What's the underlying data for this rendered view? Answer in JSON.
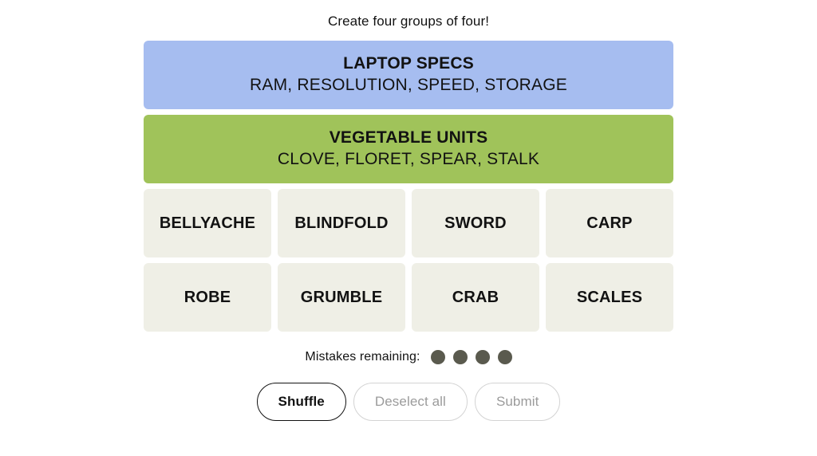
{
  "game": {
    "tagline": "Create four groups of four!",
    "palette": {
      "page_background": "#ffffff",
      "tile_background": "#efefe6",
      "tile_text": "#121212",
      "dot_color": "#5a5a4e",
      "enabled_button_border": "#121212",
      "disabled_button_border": "#d3d3d3",
      "disabled_button_text": "#9b9b9b"
    },
    "solved_groups": [
      {
        "title": "LAPTOP SPECS",
        "members": "RAM, RESOLUTION, SPEED, STORAGE",
        "color": "#a6bdf0",
        "difficulty": "purple"
      },
      {
        "title": "VEGETABLE UNITS",
        "members": "CLOVE, FLORET, SPEAR, STALK",
        "color": "#a0c35a",
        "difficulty": "green"
      }
    ],
    "tile_rows": [
      [
        "BELLYACHE",
        "BLINDFOLD",
        "SWORD",
        "CARP"
      ],
      [
        "ROBE",
        "GRUMBLE",
        "CRAB",
        "SCALES"
      ]
    ],
    "mistakes": {
      "label": "Mistakes remaining:",
      "remaining": 4
    },
    "buttons": [
      {
        "label": "Shuffle",
        "enabled": true
      },
      {
        "label": "Deselect all",
        "enabled": false
      },
      {
        "label": "Submit",
        "enabled": false
      }
    ]
  }
}
